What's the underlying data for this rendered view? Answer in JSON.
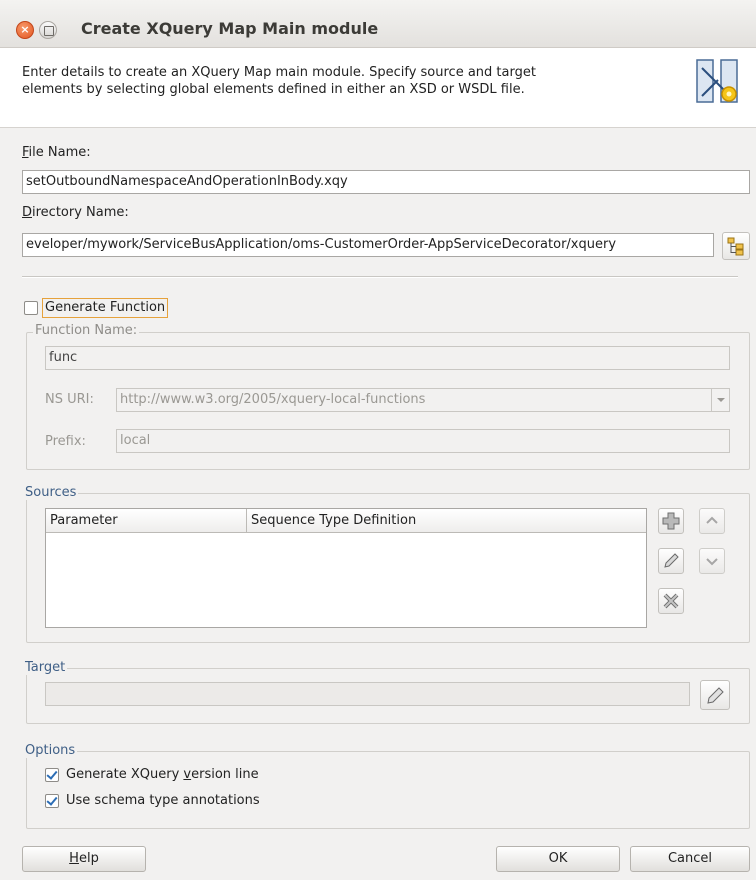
{
  "window": {
    "title": "Create XQuery Map Main module",
    "close_glyph": "×"
  },
  "header": {
    "description_line1": "Enter details to create an XQuery Map main module. Specify source and target",
    "description_line2": "elements by selecting global elements defined in either an XSD or WSDL file.",
    "icon": "xquery-map-wizard-icon"
  },
  "file_name": {
    "label_mnemonic": "F",
    "label_rest": "ile Name:",
    "value": "setOutboundNamespaceAndOperationInBody.xqy"
  },
  "directory_name": {
    "label_mnemonic": "D",
    "label_rest": "irectory Name:",
    "value": "eveloper/mywork/ServiceBusApplication/oms-CustomerOrder-AppServiceDecorator/xquery",
    "browse_icon": "folder-tree-icon"
  },
  "generate_function": {
    "label": "Generate Function",
    "checked": false
  },
  "function_group": {
    "legend": "Function Name:",
    "function_name_value": "func",
    "ns_uri_label": "NS URI:",
    "ns_uri_value": "http://www.w3.org/2005/xquery-local-functions",
    "prefix_label": "Prefix:",
    "prefix_value": "local"
  },
  "sources": {
    "legend": "Sources",
    "columns": [
      "Parameter",
      "Sequence Type Definition"
    ],
    "rows": []
  },
  "target": {
    "legend": "Target",
    "value": ""
  },
  "options": {
    "legend": "Options",
    "generate_version_label_pre": "Generate XQuery ",
    "generate_version_label_mnemonic": "v",
    "generate_version_label_post": "ersion line",
    "generate_version_checked": true,
    "schema_annotations_label": "Use schema type annotations",
    "schema_annotations_checked": true
  },
  "buttons": {
    "help_mnemonic": "H",
    "help_rest": "elp",
    "ok": "OK",
    "cancel": "Cancel"
  },
  "colors": {
    "close_button": "#e2551f",
    "group_legend": "#3f5f86",
    "checkbox_tick": "#2c6db5",
    "focus_outline": "#e6a23c"
  }
}
